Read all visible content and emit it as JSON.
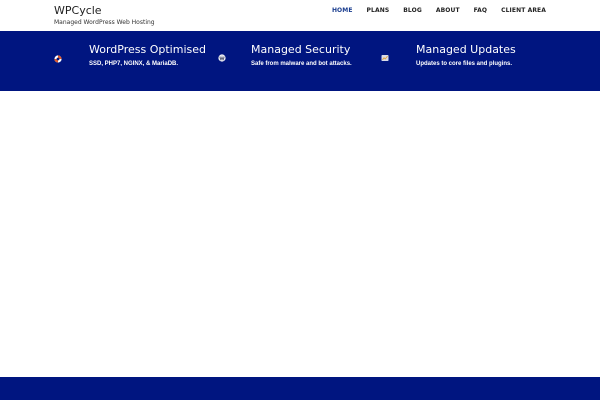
{
  "site": {
    "title": "WPCycle",
    "tagline": "Managed WordPress Web Hosting"
  },
  "nav": {
    "home": "HOME",
    "plans": "PLANS",
    "blog": "BLOG",
    "about": "ABOUT",
    "faq": "FAQ",
    "client_area": "CLIENT AREA"
  },
  "features": [
    {
      "icon": "lifebuoy-icon",
      "title": "WordPress Optimised",
      "text": "SSD, PHP7, NGINX, & MariaDB."
    },
    {
      "icon": "wordpress-icon",
      "title": "Managed Security",
      "text": "Safe from malware and bot attacks."
    },
    {
      "icon": "update-icon",
      "title": "Managed Updates",
      "text": "Updates to core files and plugins."
    }
  ],
  "colors": {
    "band": "#001580",
    "active_nav": "#1a3d8f",
    "text_dark": "#222222"
  }
}
